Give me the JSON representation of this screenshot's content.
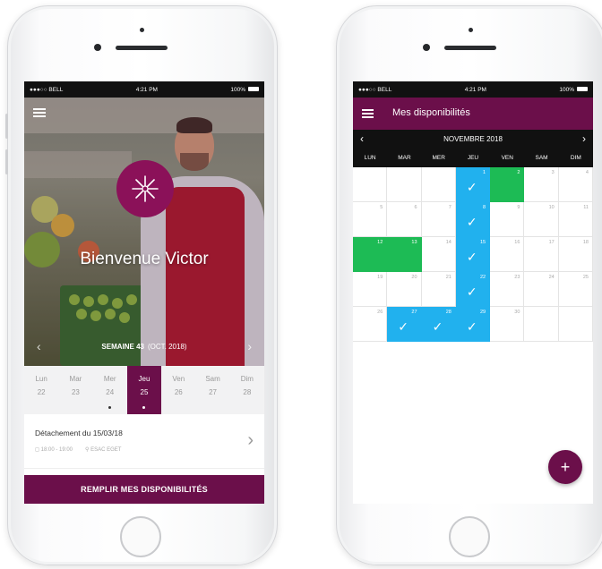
{
  "left_phone": {
    "status": {
      "carrier": "●●●○○ BELL",
      "time": "4:21 PM",
      "battery": "100%"
    },
    "welcome": "Bienvenue Victor",
    "week": {
      "label": "SEMAINE 43",
      "dates": "(OCT. 2018)"
    },
    "days": [
      {
        "name": "Lun",
        "num": "22",
        "active": false,
        "dot": false
      },
      {
        "name": "Mar",
        "num": "23",
        "active": false,
        "dot": false
      },
      {
        "name": "Mer",
        "num": "24",
        "active": false,
        "dot": true
      },
      {
        "name": "Jeu",
        "num": "25",
        "active": true,
        "dot": true
      },
      {
        "name": "Ven",
        "num": "26",
        "active": false,
        "dot": false
      },
      {
        "name": "Sam",
        "num": "27",
        "active": false,
        "dot": false
      },
      {
        "name": "Dim",
        "num": "28",
        "active": false,
        "dot": false
      }
    ],
    "card": {
      "title": "Détachement du 15/03/18",
      "time": "18:00 - 19:00",
      "place": "ESAC EGET"
    },
    "cta": "REMPLIR MES DISPONIBILITÉS"
  },
  "right_phone": {
    "status": {
      "carrier": "●●●○○ BELL",
      "time": "4:21 PM",
      "battery": "100%"
    },
    "title": "Mes disponibilités",
    "month": "NOVEMBRE 2018",
    "weekdays": [
      "LUN",
      "MAR",
      "MER",
      "JEU",
      "VEN",
      "SAM",
      "DIM"
    ],
    "calendar": [
      [
        "",
        "",
        "",
        "1",
        "2",
        "3",
        "4"
      ],
      [
        "5",
        "6",
        "7",
        "8",
        "9",
        "10",
        "11"
      ],
      [
        "12",
        "13",
        "14",
        "15",
        "16",
        "17",
        "18"
      ],
      [
        "19",
        "20",
        "21",
        "22",
        "23",
        "24",
        "25"
      ],
      [
        "26",
        "27",
        "28",
        "29",
        "30",
        "",
        ""
      ]
    ],
    "blue_days": [
      "1",
      "8",
      "15",
      "22",
      "27",
      "28",
      "29"
    ],
    "checked_days": [
      "1",
      "8",
      "15",
      "22",
      "27",
      "28",
      "29"
    ],
    "green_days": [
      "2",
      "12",
      "13"
    ],
    "fab": "+"
  },
  "colors": {
    "brand": "#6b0f4a",
    "blue": "#21b1ee",
    "green": "#1dbb55"
  }
}
